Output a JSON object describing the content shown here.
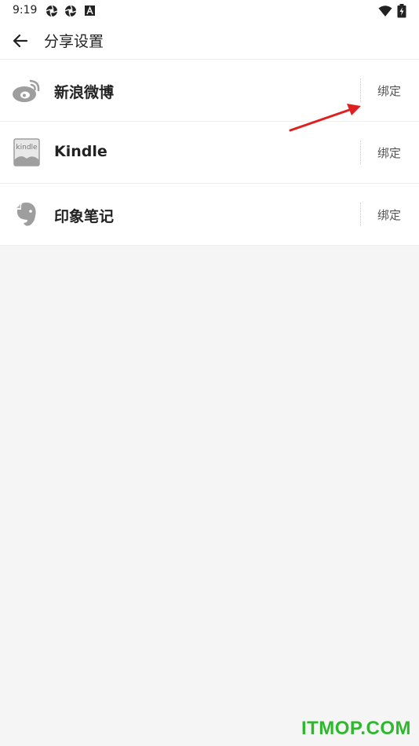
{
  "status_bar": {
    "time": "9:19",
    "icons": [
      "aperture-icon",
      "aperture-icon",
      "a-badge-icon"
    ],
    "right_icons": [
      "wifi-icon",
      "battery-charging-icon"
    ]
  },
  "app_bar": {
    "back_icon": "arrow-left-icon",
    "title": "分享设置"
  },
  "share_items": [
    {
      "icon": "weibo-icon",
      "label": "新浪微博",
      "action": "绑定"
    },
    {
      "icon": "kindle-icon",
      "label": "Kindle",
      "action": "绑定"
    },
    {
      "icon": "evernote-icon",
      "label": "印象笔记",
      "action": "绑定"
    }
  ],
  "annotation": {
    "color": "#e02020"
  },
  "watermark": {
    "text": "ITMOP.COM",
    "color": "#2eb82e"
  }
}
